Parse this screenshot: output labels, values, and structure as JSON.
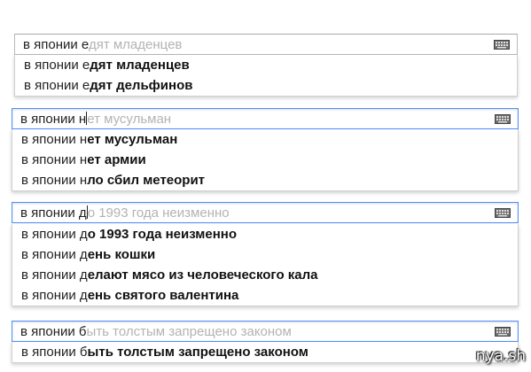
{
  "colors": {
    "focus_border": "#4d90fe",
    "hint_text": "#b3b3b3",
    "text": "#222222"
  },
  "icons": {
    "keyboard": "keyboard-icon"
  },
  "blocks": [
    {
      "query_typed": "в японии е",
      "query_hint": "дят младенцев",
      "suggestions": [
        {
          "prefix": "в японии е",
          "completion": "дят младенцев"
        },
        {
          "prefix": "в японии е",
          "completion": "дят дельфинов"
        }
      ]
    },
    {
      "query_typed": "в японии н",
      "query_hint": "ет мусульман",
      "suggestions": [
        {
          "prefix": "в японии н",
          "completion": "ет мусульман"
        },
        {
          "prefix": "в японии н",
          "completion": "ет армии"
        },
        {
          "prefix": "в японии н",
          "completion": "ло сбил метеорит"
        }
      ]
    },
    {
      "query_typed": "в японии д",
      "query_hint": "о 1993 года неизменно",
      "suggestions": [
        {
          "prefix": "в японии д",
          "completion": "о 1993 года неизменно"
        },
        {
          "prefix": "в японии д",
          "completion": "ень кошки"
        },
        {
          "prefix": "в японии д",
          "completion": "елают мясо из человеческого кала"
        },
        {
          "prefix": "в японии д",
          "completion": "ень святого валентина"
        }
      ]
    },
    {
      "query_typed": "в японии б",
      "query_hint": "ыть толстым запрещено законом",
      "suggestions": [
        {
          "prefix": "в японии б",
          "completion": "ыть толстым запрещено законом"
        }
      ]
    }
  ],
  "watermark": "nya.sh"
}
